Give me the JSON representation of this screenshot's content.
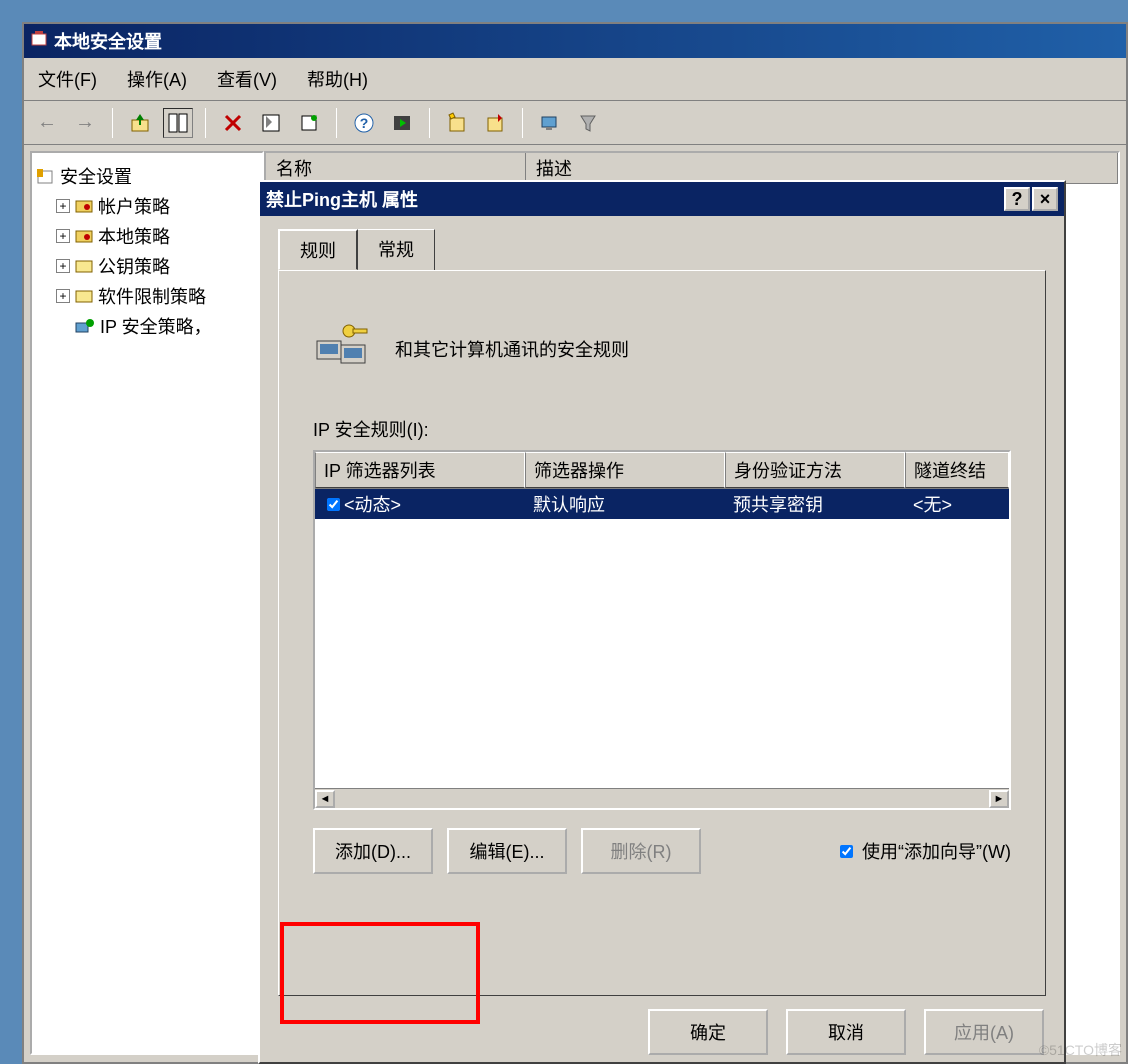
{
  "app": {
    "title": "本地安全设置"
  },
  "menu": {
    "file": "文件(F)",
    "action": "操作(A)",
    "view": "查看(V)",
    "help": "帮助(H)"
  },
  "tree": {
    "root": "安全设置",
    "n1": "帐户策略",
    "n2": "本地策略",
    "n3": "公钥策略",
    "n4": "软件限制策略",
    "n5": "IP 安全策略，"
  },
  "list_header": {
    "c1": "名称",
    "c2": "描述"
  },
  "dialog": {
    "title": "禁止Ping主机 属性",
    "tab_rules": "规则",
    "tab_general": "常规",
    "desc": "和其它计算机通讯的安全规则",
    "rules_label": "IP 安全规则(I):",
    "cols": {
      "c1": "IP 筛选器列表",
      "c2": "筛选器操作",
      "c3": "身份验证方法",
      "c4": "隧道终结"
    },
    "row": {
      "c1": "<动态>",
      "c2": "默认响应",
      "c3": "预共享密钥",
      "c4": "<无>"
    },
    "btn_add": "添加(D)...",
    "btn_edit": "编辑(E)...",
    "btn_del": "删除(R)",
    "chk_wizard": "使用“添加向导”(W)",
    "btn_ok": "确定",
    "btn_cancel": "取消",
    "btn_apply": "应用(A)"
  },
  "watermark": "©51CTO博客"
}
